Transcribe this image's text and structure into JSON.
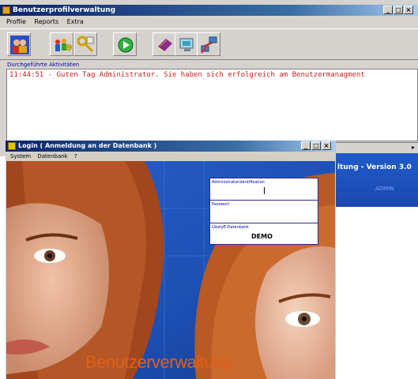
{
  "main_window": {
    "title": "Benutzerprofilverwaltung",
    "controls": [
      "_",
      "□",
      "×"
    ],
    "menu": [
      "Profile",
      "Reports",
      "Extra"
    ],
    "toolbar_icons": [
      "users-icon",
      "people-key-icon",
      "keys-icon",
      "green-go-icon",
      "book-icon",
      "monitor-icon",
      "network-icon"
    ],
    "activity_label": "Durchgeführte Aktivitäten",
    "activity_text": "11:44:51 - Guten Tag  Administrator. Sie haben sich erfolgreich am Benutzermanagment",
    "version_text": "ltung - Version 3.0",
    "strip_label": "ADMIN",
    "scroll_arrow": "▸"
  },
  "login_window": {
    "title": "Login ( Anmeldung an der Datenbank )",
    "controls": [
      "_",
      "□",
      "×"
    ],
    "menu": [
      "System",
      "Datenbank",
      "?"
    ],
    "brand": "Benutzerverwaltung",
    "fields": {
      "admin_label": "Administratoridentifikation",
      "password_label": "Passwort",
      "db_label": "LibelyE Datenbank",
      "db_value": "DEMO"
    }
  },
  "colors": {
    "accent_title": "#0a246a",
    "activity_text": "#c81e1e",
    "brand": "#e06018",
    "photo_blue": "#1d4fb4"
  }
}
